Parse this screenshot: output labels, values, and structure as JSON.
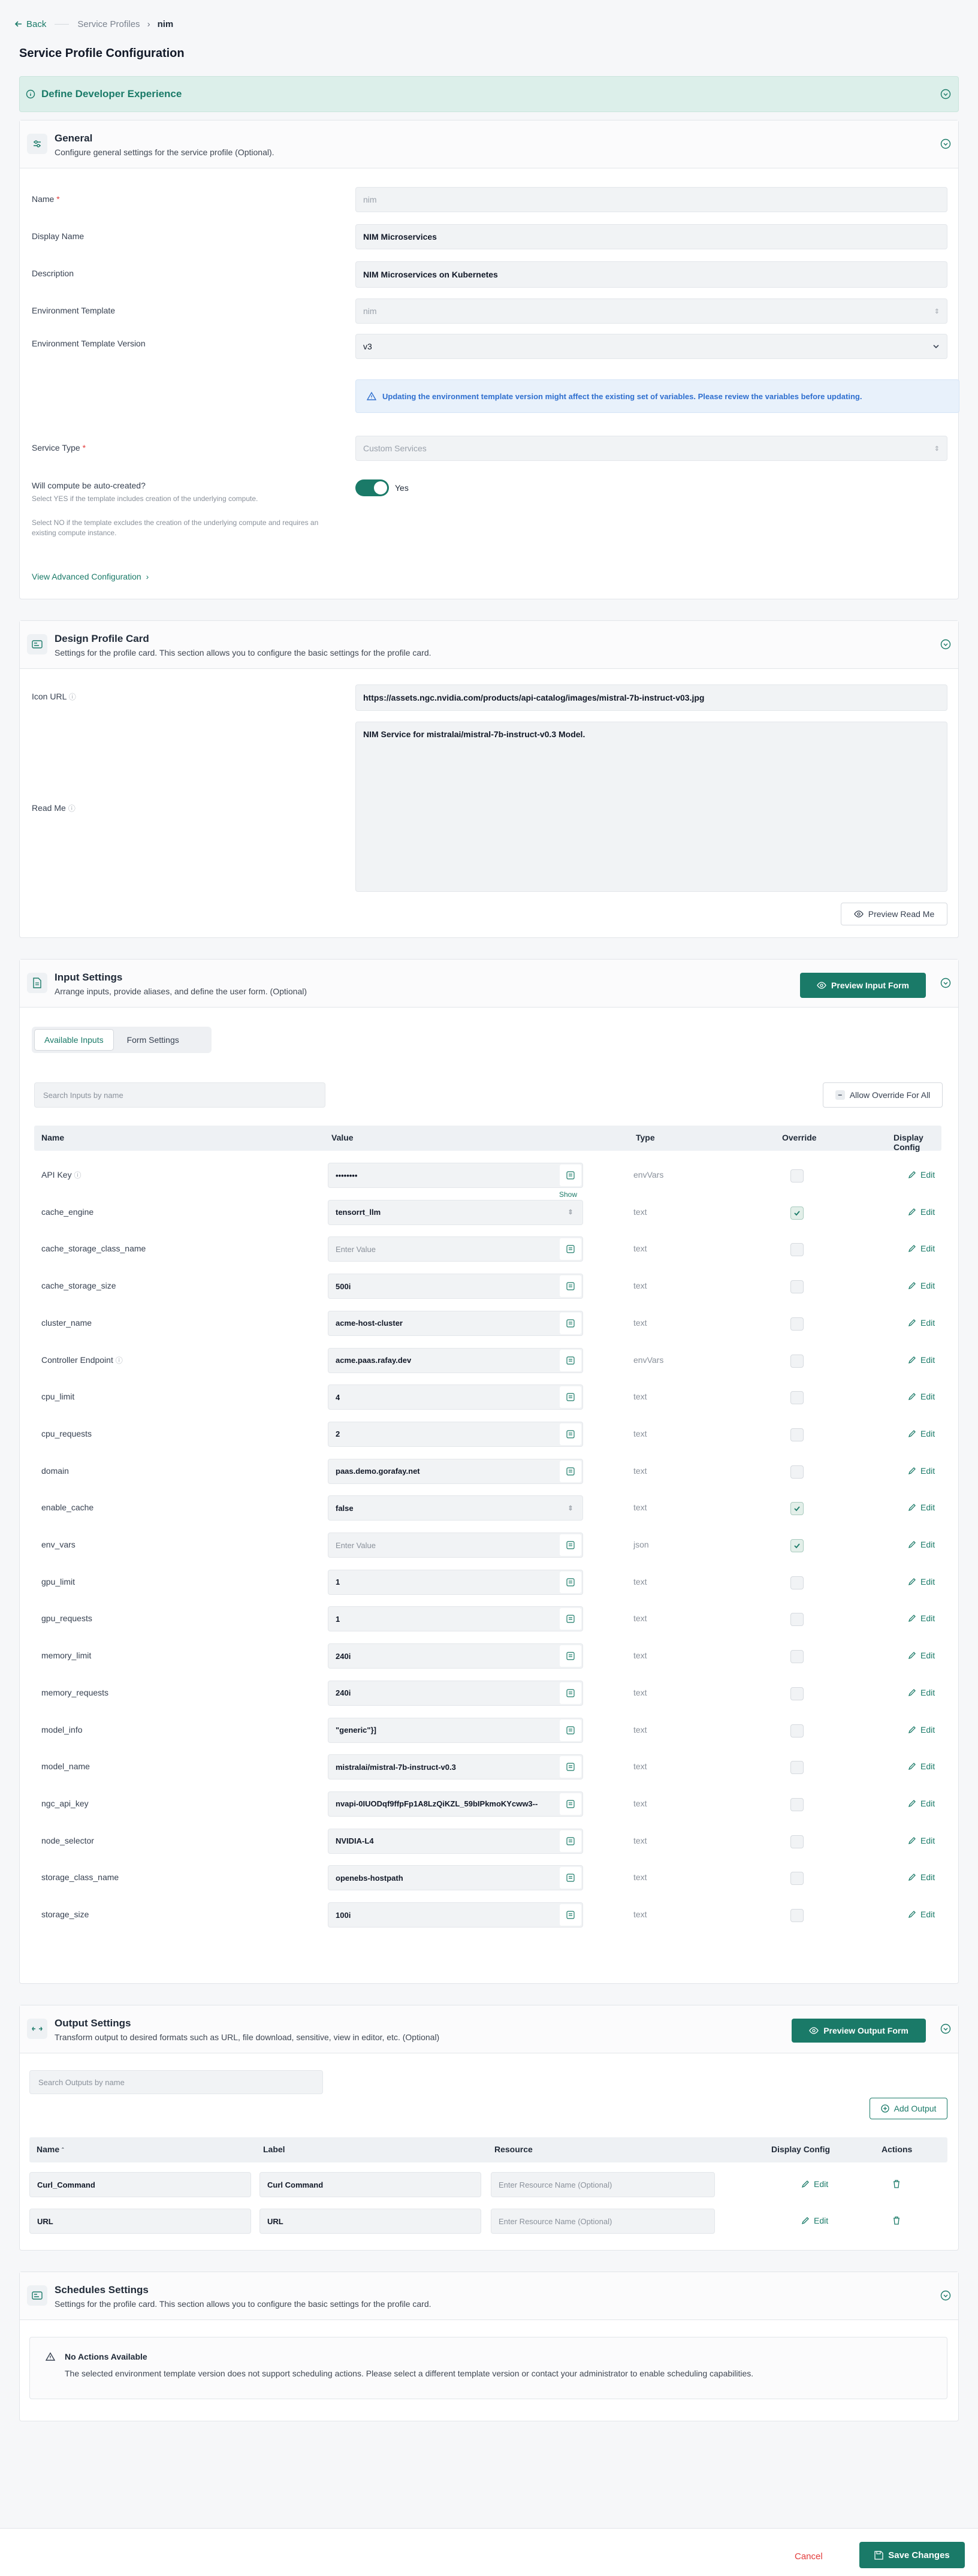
{
  "breadcrumb": {
    "back": "Back",
    "parent": "Service Profiles",
    "current": "nim"
  },
  "page_title": "Service Profile Configuration",
  "banner": {
    "title": "Define Developer Experience"
  },
  "general": {
    "title": "General",
    "subtitle": "Configure general settings for the service profile (Optional).",
    "name_label": "Name",
    "name_value": "nim",
    "display_name_label": "Display Name",
    "display_name_value": "NIM Microservices",
    "description_label": "Description",
    "description_value": "NIM Microservices on Kubernetes",
    "env_template_label": "Environment Template",
    "env_template_value": "nim",
    "env_template_version_label": "Environment Template Version",
    "env_template_version_value": "v3",
    "version_note": "Updating the environment template version might affect the existing set of variables. Please review the variables before updating.",
    "service_type_label": "Service Type",
    "service_type_value": "Custom Services",
    "auto_create_label": "Will compute be auto-created?",
    "auto_create_help1": "Select YES if the template includes creation of the underlying compute.",
    "auto_create_help2": "Select NO if the template excludes the creation of the underlying compute and requires an existing compute instance.",
    "auto_create_value": "Yes",
    "advanced_link": "View Advanced Configuration"
  },
  "design": {
    "title": "Design Profile Card",
    "subtitle": "Settings for the profile card. This section allows you to configure the basic settings for the profile card.",
    "icon_url_label": "Icon URL",
    "icon_url_value": "https://assets.ngc.nvidia.com/products/api-catalog/images/mistral-7b-instruct-v03.jpg",
    "readme_label": "Read Me",
    "readme_value": "NIM Service for mistralai/mistral-7b-instruct-v0.3 Model.",
    "preview_readme": "Preview Read Me"
  },
  "inputs": {
    "title": "Input Settings",
    "subtitle": "Arrange inputs, provide aliases, and define the user form. (Optional)",
    "preview_button": "Preview Input Form",
    "tabs": [
      "Available Inputs",
      "Form Settings"
    ],
    "search_placeholder": "Search Inputs by name",
    "allow_override": "Allow Override For All",
    "columns": [
      "Name",
      "Value",
      "Type",
      "Override",
      "Display Config"
    ],
    "show_label": "Show",
    "edit_label": "Edit",
    "rows": [
      {
        "name": "API Key",
        "value": "••••••••",
        "type": "envVars",
        "override": false
      },
      {
        "name": "cache_engine",
        "value": "tensorrt_llm",
        "type": "text",
        "override": true
      },
      {
        "name": "cache_storage_class_name",
        "value": "Enter Value",
        "type": "text",
        "override": false
      },
      {
        "name": "cache_storage_size",
        "value": "500i",
        "type": "text",
        "override": false
      },
      {
        "name": "cluster_name",
        "value": "acme-host-cluster",
        "type": "text",
        "override": false
      },
      {
        "name": "Controller Endpoint",
        "value": "acme.paas.rafay.dev",
        "type": "envVars",
        "override": false
      },
      {
        "name": "cpu_limit",
        "value": "4",
        "type": "text",
        "override": false
      },
      {
        "name": "cpu_requests",
        "value": "2",
        "type": "text",
        "override": false
      },
      {
        "name": "domain",
        "value": "paas.demo.gorafay.net",
        "type": "text",
        "override": false
      },
      {
        "name": "enable_cache",
        "value": "false",
        "type": "text",
        "override": true
      },
      {
        "name": "env_vars",
        "value": "Enter Value",
        "type": "json",
        "override": true
      },
      {
        "name": "gpu_limit",
        "value": "1",
        "type": "text",
        "override": false
      },
      {
        "name": "gpu_requests",
        "value": "1",
        "type": "text",
        "override": false
      },
      {
        "name": "memory_limit",
        "value": "240i",
        "type": "text",
        "override": false
      },
      {
        "name": "memory_requests",
        "value": "240i",
        "type": "text",
        "override": false
      },
      {
        "name": "model_info",
        "value": "\"generic\"}]",
        "type": "text",
        "override": false
      },
      {
        "name": "model_name",
        "value": "mistralai/mistral-7b-instruct-v0.3",
        "type": "text",
        "override": false
      },
      {
        "name": "ngc_api_key",
        "value": "nvapi-0IUODqf9ffpFp1A8LzQiKZL_59bIPkmoKYcww3--",
        "type": "text",
        "override": false
      },
      {
        "name": "node_selector",
        "value": "NVIDIA-L4",
        "type": "text",
        "override": false
      },
      {
        "name": "storage_class_name",
        "value": "openebs-hostpath",
        "type": "text",
        "override": false
      },
      {
        "name": "storage_size",
        "value": "100i",
        "type": "text",
        "override": false
      }
    ]
  },
  "outputs": {
    "title": "Output Settings",
    "subtitle": "Transform output to desired formats such as URL, file download, sensitive, view in editor, etc. (Optional)",
    "preview_button": "Preview Output Form",
    "search_placeholder": "Search Outputs by name",
    "add_output": "Add Output",
    "columns": [
      "Name",
      "Label",
      "Resource",
      "Display Config",
      "Actions"
    ],
    "resource_placeholder": "Enter Resource Name (Optional)",
    "edit_label": "Edit",
    "rows": [
      {
        "name": "Curl_Command",
        "label": "Curl Command"
      },
      {
        "name": "URL",
        "label": "URL"
      }
    ]
  },
  "schedules": {
    "title": "Schedules Settings",
    "subtitle": "Settings for the profile card. This section allows you to configure the basic settings for the profile card.",
    "notice_title": "No Actions Available",
    "notice_text": "The selected environment template version does not support scheduling actions. Please select a different template version or contact your administrator to enable scheduling capabilities."
  },
  "footer": {
    "cancel": "Cancel",
    "save": "Save Changes"
  },
  "colors": {
    "accent": "#1a7a68",
    "info": "#2f6fcf",
    "danger": "#e23b3b"
  }
}
